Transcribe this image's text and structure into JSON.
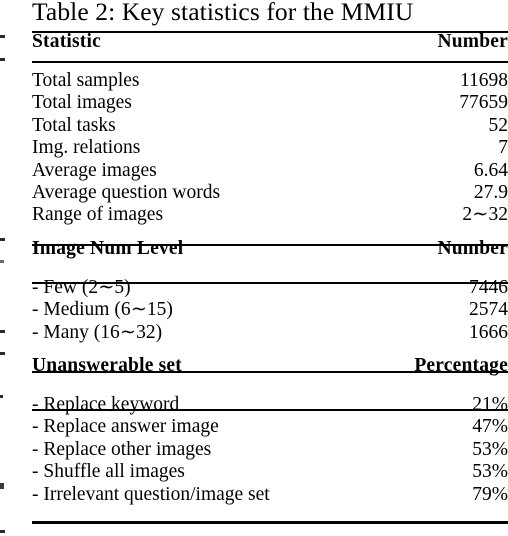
{
  "caption": {
    "text": "Table 2: Key statistics for the MMIU"
  },
  "table": {
    "sections": [
      {
        "header": {
          "label": "Statistic",
          "value": "Number"
        },
        "rows": [
          {
            "label": "Total samples",
            "value": "11698"
          },
          {
            "label": "Total images",
            "value": "77659"
          },
          {
            "label": "Total tasks",
            "value": "52"
          },
          {
            "label": "Img. relations",
            "value": "7"
          },
          {
            "label": "Average images",
            "value": "6.64"
          },
          {
            "label": "Average question words",
            "value": "27.9"
          },
          {
            "label": "Range of images",
            "value": "2∼32"
          }
        ]
      },
      {
        "header": {
          "label": "Image Num Level",
          "value": "Number"
        },
        "rows": [
          {
            "label": "- Few (2∼5)",
            "value": "7446"
          },
          {
            "label": "- Medium (6∼15)",
            "value": "2574"
          },
          {
            "label": "- Many (16∼32)",
            "value": "1666"
          }
        ]
      },
      {
        "header": {
          "label": "Unanswerable set",
          "value": "Percentage"
        },
        "rows": [
          {
            "label": "- Replace keyword",
            "value": "21%"
          },
          {
            "label": "- Replace answer image",
            "value": "47%"
          },
          {
            "label": "- Replace other images",
            "value": "53%"
          },
          {
            "label": "- Shuffle all images",
            "value": "53%"
          },
          {
            "label": "- Irrelevant question/image set",
            "value": "79%"
          }
        ]
      }
    ]
  },
  "style": {
    "rule_color": "#000000",
    "text_color": "#000000",
    "background": "#ffffff"
  }
}
